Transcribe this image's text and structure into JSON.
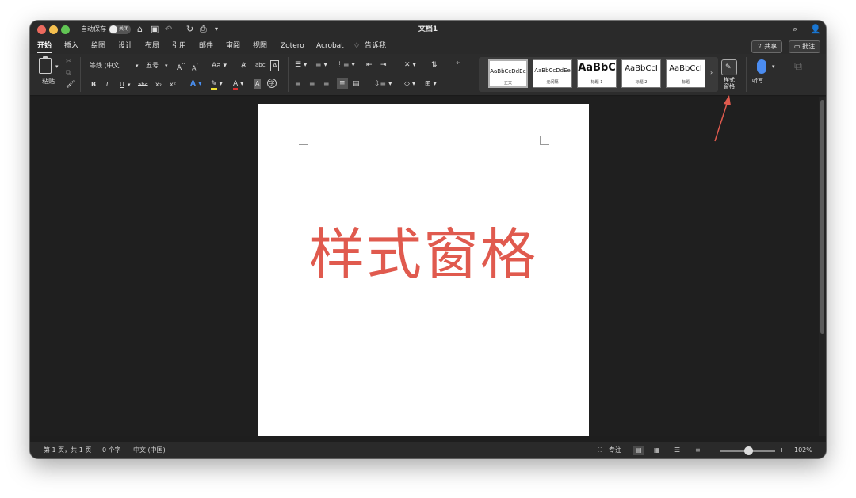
{
  "titlebar": {
    "autosave_label": "自动保存",
    "autosave_state": "关闭",
    "home_icon": "home-icon",
    "save_icon": "save-icon",
    "undo_icon": "undo-icon",
    "redo_icon": "redo-icon",
    "print_icon": "print-icon",
    "doc_title": "文档1",
    "search_icon": "search-icon",
    "account_icon": "account-icon"
  },
  "tabs": [
    "开始",
    "插入",
    "绘图",
    "设计",
    "布局",
    "引用",
    "邮件",
    "审阅",
    "视图",
    "Zotero",
    "Acrobat",
    "告诉我"
  ],
  "share_label": "共享",
  "comments_label": "批注",
  "ribbon": {
    "paste_label": "粘贴",
    "font_name": "等线 (中文...",
    "font_size": "五号",
    "grow_font": "A^",
    "shrink_font": "A˅",
    "case_label": "Aa",
    "bold": "B",
    "italic": "I",
    "underline": "U",
    "strike": "abc",
    "subscript": "x₂",
    "superscript": "x²",
    "styles": [
      {
        "sample": "AaBbCcDdEe",
        "name": "正文"
      },
      {
        "sample": "AaBbCcDdEe",
        "name": "无间隔"
      },
      {
        "sample": "AaBbC",
        "name": "标题 1"
      },
      {
        "sample": "AaBbCcI",
        "name": "标题 2"
      },
      {
        "sample": "AaBbCcI",
        "name": "标题"
      }
    ],
    "styles_pane_label": "样式\n窗格",
    "dictate_label": "听写"
  },
  "document": {
    "content": "样式窗格"
  },
  "statusbar": {
    "page": "第 1 页，共 1 页",
    "words": "0 个字",
    "language": "中文 (中国)",
    "focus": "专注",
    "zoom": "102%"
  },
  "colors": {
    "accent_red": "#e05a4e",
    "window_bg": "#1e1e1e"
  }
}
